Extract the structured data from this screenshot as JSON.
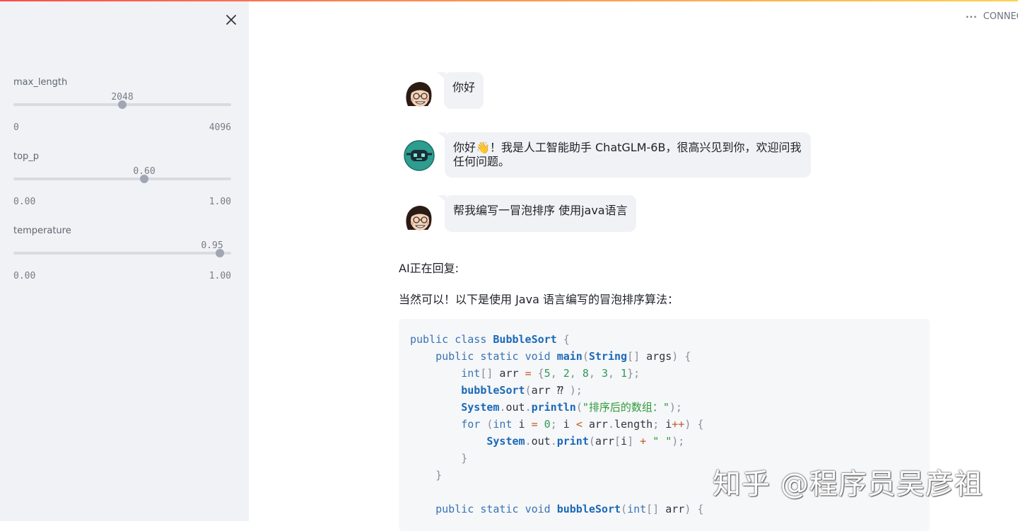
{
  "sidebar": {
    "sliders": [
      {
        "label": "max_length",
        "value": "2048",
        "min": "0",
        "max": "4096",
        "fraction": 0.5
      },
      {
        "label": "top_p",
        "value": "0.60",
        "min": "0.00",
        "max": "1.00",
        "fraction": 0.6
      },
      {
        "label": "temperature",
        "value": "0.95",
        "min": "0.00",
        "max": "1.00",
        "fraction": 0.95
      }
    ]
  },
  "status": {
    "label": "CONNEC"
  },
  "chat": {
    "messages": [
      {
        "role": "user",
        "text": "你好"
      },
      {
        "role": "assistant",
        "text_line1": "你好👋！我是人工智能助手 ChatGLM-6B，很高兴见到你，欢迎问我",
        "text_line2": "任何问题。"
      },
      {
        "role": "user",
        "text": "帮我编写一冒泡排序 使用java语言"
      }
    ],
    "replying_label": "AI正在回复:",
    "reply_intro": "当然可以！以下是使用 Java 语言编写的冒泡排序算法："
  },
  "code": {
    "language": "java",
    "lines": [
      "public class BubbleSort {",
      "    public static void main(String[] args) {",
      "        int[] arr = {5, 2, 8, 3, 1};",
      "        bubbleSort(arr ⁇ );",
      "        System.out.println(\"排序后的数组：\");",
      "        for (int i = 0; i < arr.length; i++) {",
      "            System.out.print(arr[i] + \" \");",
      "        }",
      "    }",
      "",
      "    public static void bubbleSort(int[] arr) {"
    ]
  },
  "watermark": "知乎 @程序员吴彦祖",
  "colors": {
    "sidebar_bg": "#f0f2f6",
    "bubble_bg": "#f0f2f6",
    "code_bg": "#f6f7f9",
    "slider_thumb": "#a0a6b2"
  }
}
